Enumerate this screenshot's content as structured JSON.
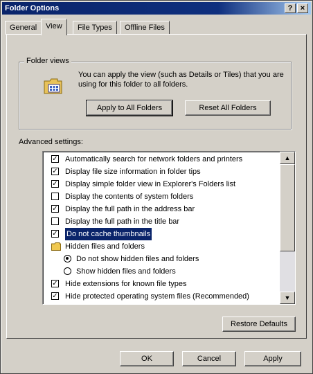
{
  "window": {
    "title": "Folder Options",
    "help_label": "?",
    "close_label": "×"
  },
  "tabs": [
    {
      "label": "General"
    },
    {
      "label": "View"
    },
    {
      "label": "File Types"
    },
    {
      "label": "Offline Files"
    }
  ],
  "active_tab": "View",
  "folder_views": {
    "legend": "Folder views",
    "description": "You can apply the view (such as Details or Tiles) that you are using for this folder to all folders.",
    "apply_label": "Apply to All Folders",
    "reset_label": "Reset All Folders",
    "icon": "folder-icon"
  },
  "advanced": {
    "label": "Advanced settings:",
    "items": [
      {
        "type": "checkbox",
        "checked": true,
        "label": "Automatically search for network folders and printers"
      },
      {
        "type": "checkbox",
        "checked": true,
        "label": "Display file size information in folder tips"
      },
      {
        "type": "checkbox",
        "checked": true,
        "label": "Display simple folder view in Explorer's Folders list"
      },
      {
        "type": "checkbox",
        "checked": false,
        "label": "Display the contents of system folders"
      },
      {
        "type": "checkbox",
        "checked": true,
        "label": "Display the full path in the address bar"
      },
      {
        "type": "checkbox",
        "checked": false,
        "label": "Display the full path in the title bar"
      },
      {
        "type": "checkbox",
        "checked": true,
        "label": "Do not cache thumbnails",
        "selected": true
      },
      {
        "type": "folder",
        "label": "Hidden files and folders"
      },
      {
        "type": "radio",
        "checked": true,
        "label": "Do not show hidden files and folders"
      },
      {
        "type": "radio",
        "checked": false,
        "label": "Show hidden files and folders"
      },
      {
        "type": "checkbox",
        "checked": true,
        "label": "Hide extensions for known file types"
      },
      {
        "type": "checkbox",
        "checked": true,
        "label": "Hide protected operating system files (Recommended)"
      }
    ],
    "restore_label": "Restore Defaults"
  },
  "footer": {
    "ok_label": "OK",
    "cancel_label": "Cancel",
    "apply_label": "Apply"
  },
  "colors": {
    "titlebar": "#0a246a",
    "face": "#d4d0c8",
    "selection": "#0a246a"
  }
}
